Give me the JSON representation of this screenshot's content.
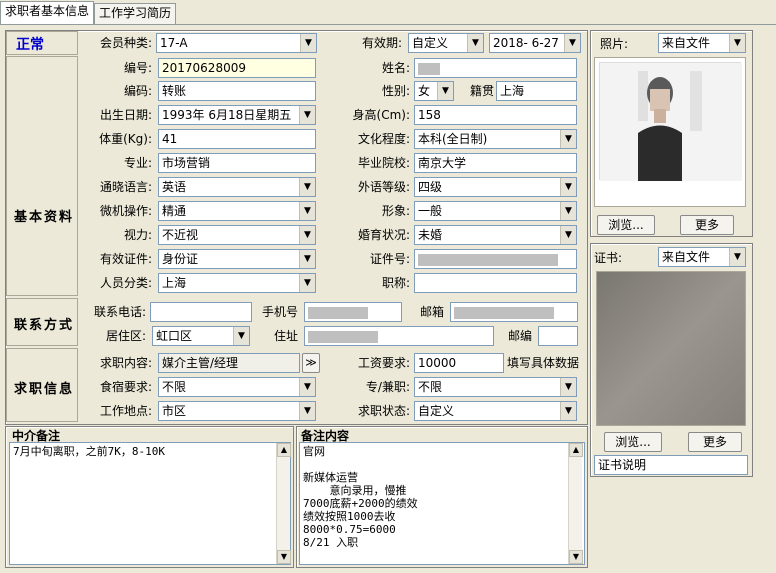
{
  "tabs": [
    "求职者基本信息",
    "工作学习简历"
  ],
  "status": "正常",
  "membership": {
    "label": "会员种类:",
    "value": "17-A"
  },
  "validity": {
    "label": "有效期:",
    "type": "自定义",
    "date": "2018- 6-27"
  },
  "sections": {
    "basic": "基本资料",
    "contact": "联系方式",
    "job": "求职信息"
  },
  "basic": {
    "number": {
      "label": "编号:",
      "value": "20170628009"
    },
    "name": {
      "label": "姓名:"
    },
    "code": {
      "label": "编码:",
      "value": "转账"
    },
    "gender": {
      "label": "性别:",
      "value": "女"
    },
    "native": {
      "label": "籍贯",
      "value": "上海"
    },
    "birth": {
      "label": "出生日期:",
      "value": "1993年 6月18日星期五"
    },
    "height": {
      "label": "身高(Cm):",
      "value": "158"
    },
    "weight": {
      "label": "体重(Kg):",
      "value": "41"
    },
    "education": {
      "label": "文化程度:",
      "value": "本科(全日制)"
    },
    "major": {
      "label": "专业:",
      "value": "市场营销"
    },
    "school": {
      "label": "毕业院校:",
      "value": "南京大学"
    },
    "language": {
      "label": "通晓语言:",
      "value": "英语"
    },
    "foreign_level": {
      "label": "外语等级:",
      "value": "四级"
    },
    "computer": {
      "label": "微机操作:",
      "value": "精通"
    },
    "image": {
      "label": "形象:",
      "value": "一般"
    },
    "vision": {
      "label": "视力:",
      "value": "不近视"
    },
    "marital": {
      "label": "婚育状况:",
      "value": "未婚"
    },
    "id_type": {
      "label": "有效证件:",
      "value": "身份证"
    },
    "id_number": {
      "label": "证件号:"
    },
    "category": {
      "label": "人员分类:",
      "value": "上海"
    },
    "title": {
      "label": "职称:",
      "value": ""
    }
  },
  "contact": {
    "phone": {
      "label": "联系电话:",
      "value": ""
    },
    "mobile": {
      "label": "手机号"
    },
    "email": {
      "label": "邮箱"
    },
    "district": {
      "label": "居住区:",
      "value": "虹口区"
    },
    "address": {
      "label": "住址"
    },
    "postcode": {
      "label": "邮编",
      "value": ""
    }
  },
  "job": {
    "content": {
      "label": "求职内容:",
      "value": "媒介主管/经理",
      "more": "≫"
    },
    "salary": {
      "label": "工资要求:",
      "value": "10000",
      "hint": "填写具体数据"
    },
    "board": {
      "label": "食宿要求:",
      "value": "不限"
    },
    "parttime": {
      "label": "专/兼职:",
      "value": "不限"
    },
    "location": {
      "label": "工作地点:",
      "value": "市区"
    },
    "status": {
      "label": "求职状态:",
      "value": "自定义"
    }
  },
  "memo_agent": {
    "title": "中介备注",
    "text": "7月中旬离职，之前7K，8-10K"
  },
  "memo_notes": {
    "title": "备注内容",
    "text": "官网\n\n新媒体运营\n    意向录用，慢推\n7000底薪+2000的绩效\n绩效按照1000去收\n8000*0.75=6000\n8/21 入职"
  },
  "photo": {
    "label": "照片:",
    "source": "来自文件",
    "browse": "浏览...",
    "more": "更多"
  },
  "cert": {
    "label": "证书:",
    "source": "来自文件",
    "browse": "浏览...",
    "more": "更多",
    "desc": "证书说明"
  }
}
